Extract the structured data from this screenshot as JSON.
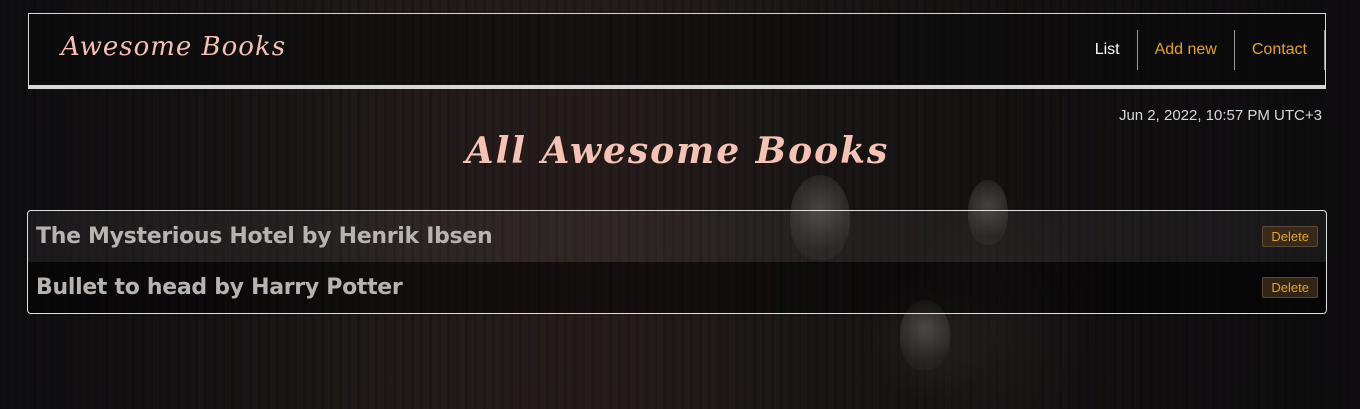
{
  "header": {
    "logo_text": "Awesome Books",
    "nav": [
      {
        "label": "List"
      },
      {
        "label": "Add new"
      },
      {
        "label": "Contact"
      }
    ]
  },
  "date_text": "Jun 2, 2022, 10:57 PM UTC+3",
  "page_title": "All Awesome Books",
  "books": [
    {
      "title": "The Mysterious Hotel by Henrik Ibsen",
      "delete_label": "Delete"
    },
    {
      "title": "Bullet to head by Harry Potter",
      "delete_label": "Delete"
    }
  ],
  "colors": {
    "accent": "#e5a229",
    "title_pink": "#f6c2b4"
  }
}
